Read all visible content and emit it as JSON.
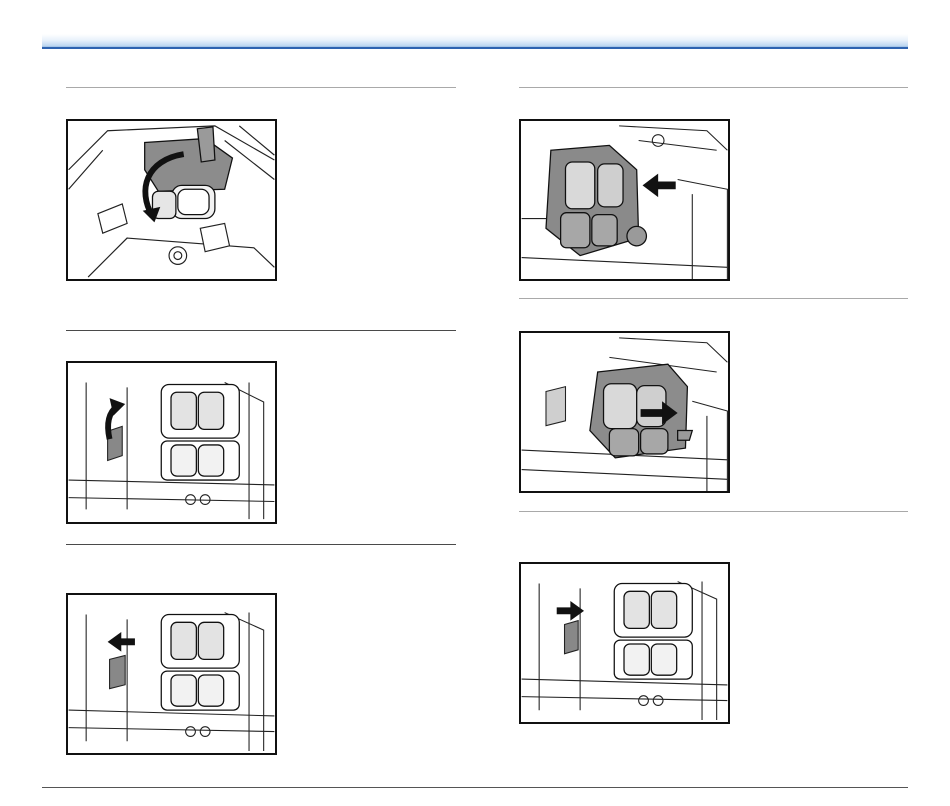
{
  "page": {
    "header": {
      "accent_color": "#2e63b0"
    },
    "figures": [
      {
        "id": "step-open-cover",
        "icon": "roller-cover-open-illustration"
      },
      {
        "id": "step-lever-up",
        "icon": "roller-lever-up-illustration"
      },
      {
        "id": "step-lever-left",
        "icon": "roller-lever-left-illustration"
      },
      {
        "id": "step-insert-roller",
        "icon": "roller-insert-illustration"
      },
      {
        "id": "step-slide-roller",
        "icon": "roller-slide-illustration"
      },
      {
        "id": "step-lever-right",
        "icon": "roller-lever-right-illustration"
      }
    ]
  }
}
